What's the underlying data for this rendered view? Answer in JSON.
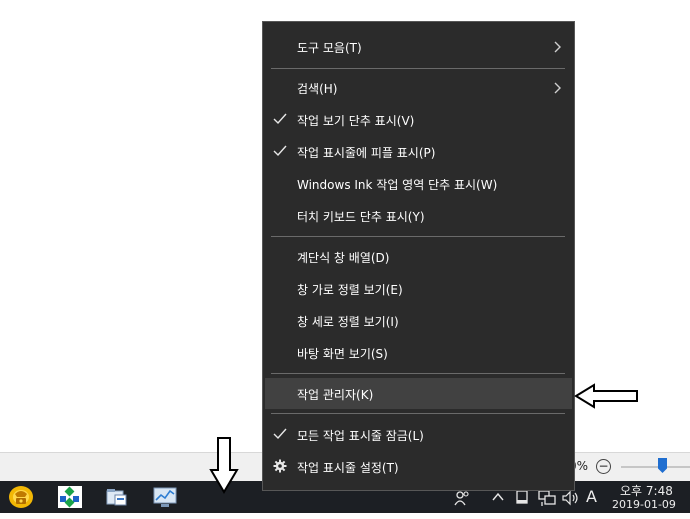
{
  "context_menu": {
    "items": [
      {
        "label": "도구 모음(T)",
        "checked": false,
        "submenu": true,
        "icon": ""
      },
      {
        "label": "검색(H)",
        "checked": false,
        "submenu": true,
        "icon": ""
      },
      {
        "label": "작업 보기 단추 표시(V)",
        "checked": true,
        "submenu": false,
        "icon": "checkmark"
      },
      {
        "label": "작업 표시줄에 피플 표시(P)",
        "checked": true,
        "submenu": false,
        "icon": "checkmark"
      },
      {
        "label": "Windows Ink 작업 영역 단추 표시(W)",
        "checked": false,
        "submenu": false,
        "icon": ""
      },
      {
        "label": "터치 키보드 단추 표시(Y)",
        "checked": false,
        "submenu": false,
        "icon": ""
      },
      {
        "label": "계단식 창 배열(D)",
        "checked": false,
        "submenu": false,
        "icon": ""
      },
      {
        "label": "창 가로 정렬 보기(E)",
        "checked": false,
        "submenu": false,
        "icon": ""
      },
      {
        "label": "창 세로 정렬 보기(I)",
        "checked": false,
        "submenu": false,
        "icon": ""
      },
      {
        "label": "바탕 화면 보기(S)",
        "checked": false,
        "submenu": false,
        "icon": ""
      },
      {
        "label": "작업 관리자(K)",
        "checked": false,
        "submenu": false,
        "icon": "",
        "highlighted": true
      },
      {
        "label": "모든 작업 표시줄 잠금(L)",
        "checked": true,
        "submenu": false,
        "icon": "checkmark"
      },
      {
        "label": "작업 표시줄 설정(T)",
        "checked": false,
        "submenu": false,
        "icon": "gear"
      }
    ]
  },
  "status_strip": {
    "zoom_text": "0%",
    "zoom_minus": "−",
    "zoom_level": 0.6
  },
  "taskbar": {
    "pinned_icons": [
      "phone-app-icon",
      "network-app-icon",
      "file-explorer-icon",
      "control-panel-icon"
    ],
    "tray_icons": [
      "people-icon",
      "show-hidden-icons-chevron",
      "notification-icon",
      "network-icon",
      "volume-icon"
    ],
    "ime_indicator": "A",
    "clock_time": "오후 7:48",
    "clock_date": "2019-01-09"
  },
  "colors": {
    "menu_bg": "#2b2b2b",
    "menu_highlight": "#414141",
    "taskbar_bg": "#1c1f24",
    "zoom_thumb": "#1f6ed0"
  }
}
